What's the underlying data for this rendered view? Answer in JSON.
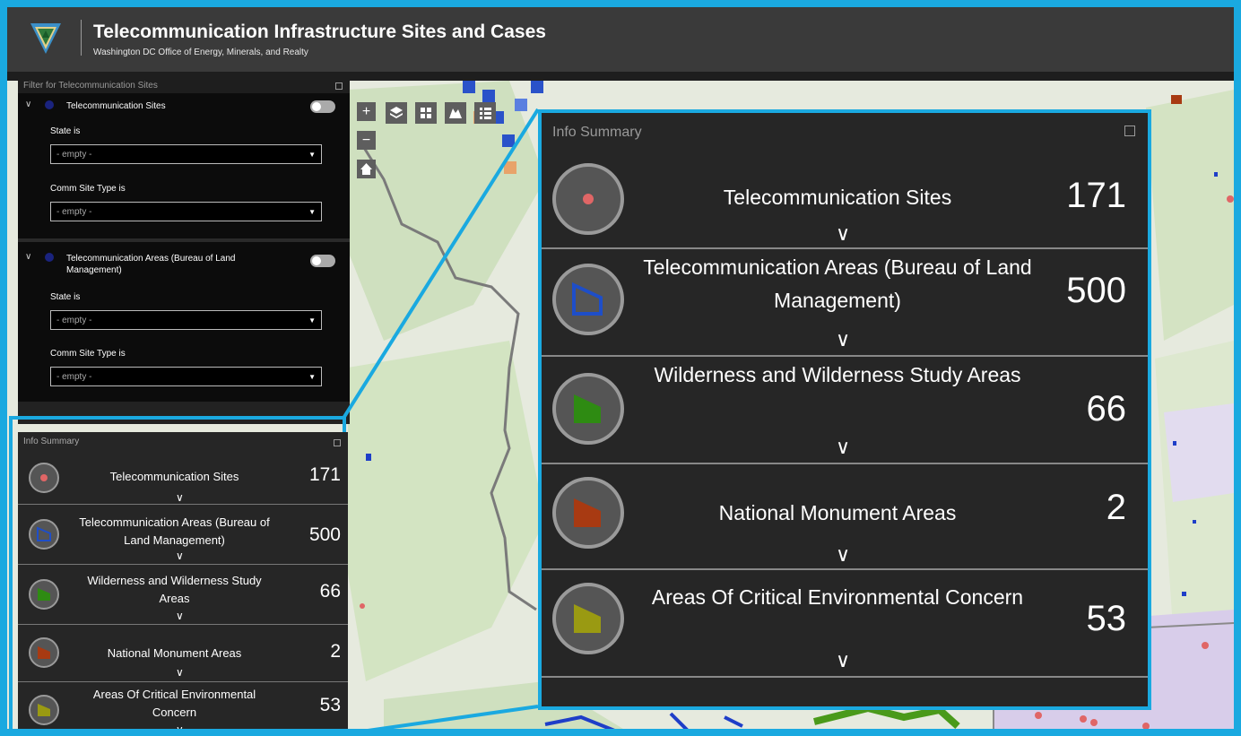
{
  "header": {
    "title": "Telecommunication Infrastructure Sites and Cases",
    "subtitle": "Washington DC Office of Energy, Minerals, and Realty"
  },
  "map_tools": {
    "zoom_in": "+",
    "zoom_out": "−"
  },
  "filter_panel": {
    "title": "Filter for Telecommunication Sites",
    "groups": [
      {
        "title": "Telecommunication Sites",
        "state_label": "State is",
        "state_value": "- empty -",
        "type_label": "Comm Site Type is",
        "type_value": "- empty -"
      },
      {
        "title": "Telecommunication Areas (Bureau of Land Management)",
        "state_label": "State is",
        "state_value": "- empty -",
        "type_label": "Comm Site Type is",
        "type_value": "- empty -"
      }
    ]
  },
  "info_summary": {
    "title": "Info Summary",
    "rows": [
      {
        "label": "Telecommunication Sites",
        "count": "171",
        "symbol": "point",
        "color": "#e06666"
      },
      {
        "label": "Telecommunication Areas (Bureau of Land Management)",
        "count": "500",
        "symbol": "polygon-outline",
        "color": "#1e4ec8"
      },
      {
        "label": "Wilderness and Wilderness Study Areas",
        "count": "66",
        "symbol": "polygon-fill",
        "color": "#2e8b12"
      },
      {
        "label": "National Monument Areas",
        "count": "2",
        "symbol": "polygon-fill",
        "color": "#a83a12"
      },
      {
        "label": "Areas Of Critical Environmental Concern",
        "count": "53",
        "symbol": "polygon-fill",
        "color": "#9a9a12"
      }
    ]
  },
  "colors": {
    "accent": "#1aa9e0",
    "header_bg": "#3a3a3a",
    "panel_bg": "#262626"
  }
}
